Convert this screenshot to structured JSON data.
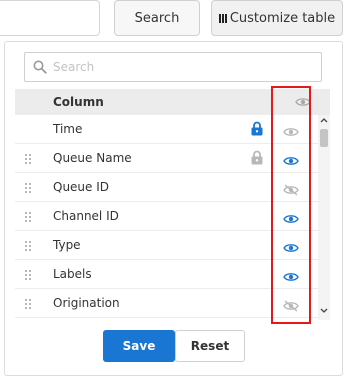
{
  "toolbar": {
    "search_label": "Search",
    "customize_label": "Customize table"
  },
  "dialog": {
    "search_placeholder": "Search",
    "column_header": "Column",
    "rows": [
      {
        "label": "Time",
        "locked": true,
        "lock_state": "blue",
        "visibility": "visible-disabled",
        "draggable": false
      },
      {
        "label": "Queue Name",
        "locked": true,
        "lock_state": "gray",
        "visibility": "visible",
        "draggable": true
      },
      {
        "label": "Queue ID",
        "locked": false,
        "visibility": "hidden",
        "draggable": true
      },
      {
        "label": "Channel ID",
        "locked": false,
        "visibility": "visible",
        "draggable": true
      },
      {
        "label": "Type",
        "locked": false,
        "visibility": "visible",
        "draggable": true
      },
      {
        "label": "Labels",
        "locked": false,
        "visibility": "visible",
        "draggable": true
      },
      {
        "label": "Origination",
        "locked": false,
        "visibility": "hidden",
        "draggable": true
      }
    ],
    "save_label": "Save",
    "reset_label": "Reset"
  },
  "colors": {
    "accent": "#1976d2",
    "highlight": "#e3191c",
    "icon_muted": "#b8b8b8"
  }
}
